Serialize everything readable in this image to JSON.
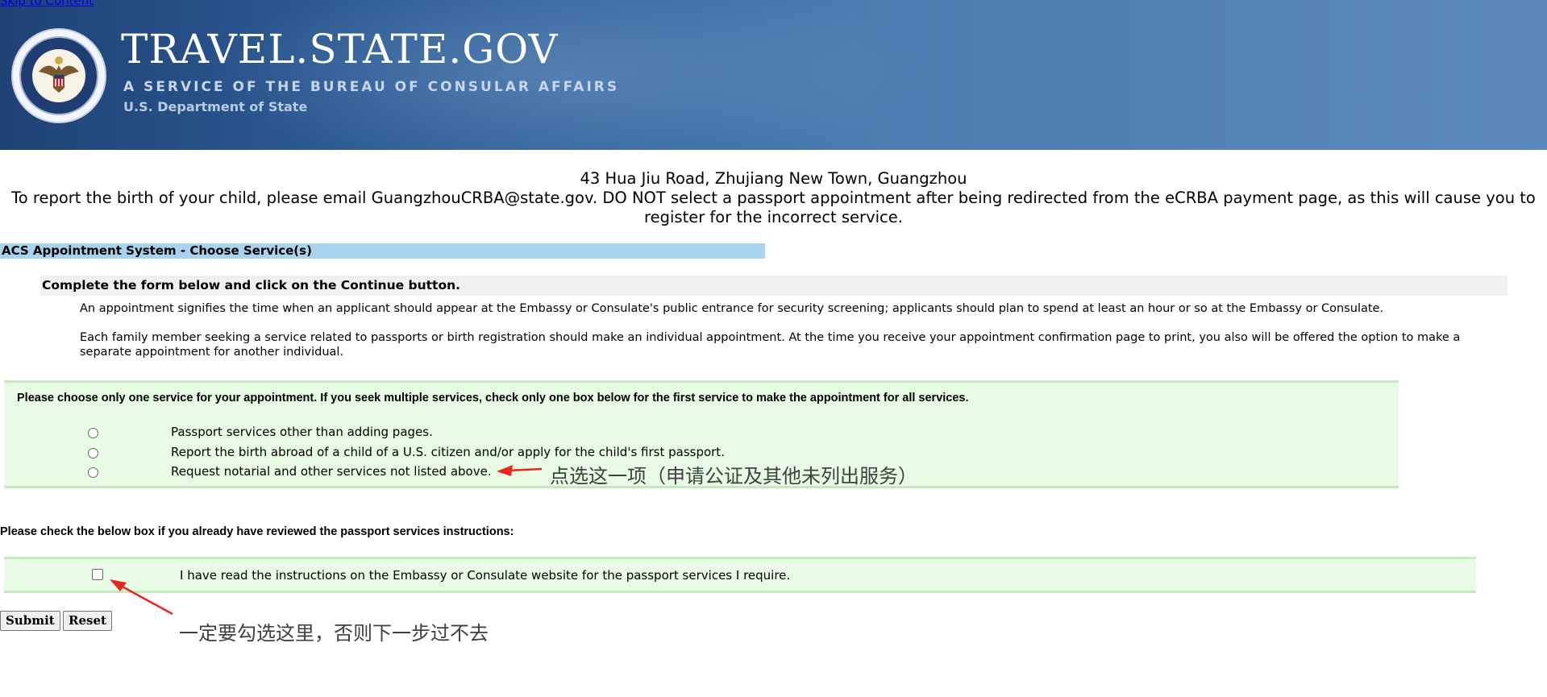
{
  "skip_link": "Skip to Content",
  "header": {
    "title": "TRAVEL.STATE.GOV",
    "subtitle": "A SERVICE OF THE BUREAU OF CONSULAR AFFAIRS",
    "department": "U.S. Department of State",
    "seal_icon": "department-of-state-seal"
  },
  "notice": {
    "address": "43 Hua Jiu Road, Zhujiang New Town, Guangzhou",
    "message": "To report the birth of your child, please email GuangzhouCRBA@state.gov. DO NOT select a passport appointment after being redirected from the eCRBA payment page, as this will cause you to register for the incorrect service."
  },
  "section_title": "ACS Appointment System - Choose Service(s)",
  "instructions": {
    "heading": "Complete the form below and click on the Continue button.",
    "para1": "An appointment signifies the time when an applicant should appear at the Embassy or Consulate's public entrance for security screening; applicants should plan to spend at least an hour or so at the Embassy or Consulate.",
    "para2": "Each family member seeking a service related to passports or birth registration should make an individual appointment. At the time you receive your appointment confirmation page to print, you also will be offered the option to make a separate appointment for another individual."
  },
  "service_choice": {
    "prompt": "Please choose only one service for your appointment. If you seek multiple services, check only one box below for the first service to make the appointment for all services.",
    "options": [
      {
        "label": "Passport services other than adding pages."
      },
      {
        "label": "Report the birth abroad of a child of a U.S. citizen and/or apply for the child's first passport."
      },
      {
        "label": "Request notarial and other services not listed above."
      }
    ]
  },
  "review": {
    "prompt": "Please check the below box if you already have reviewed the passport services instructions:",
    "checkbox_label": "I have read the instructions on the Embassy or Consulate website for the passport services I require."
  },
  "buttons": {
    "submit": "Submit",
    "reset": "Reset"
  },
  "annotations": {
    "option_note": "点选这一项（申请公证及其他未列出服务）",
    "checkbox_note": "一定要勾选这里，否则下一步过不去",
    "arrow_color": "#e8261f"
  },
  "colors": {
    "section_bar": "#a8d2ee",
    "green_box": "#e8fbe5"
  }
}
